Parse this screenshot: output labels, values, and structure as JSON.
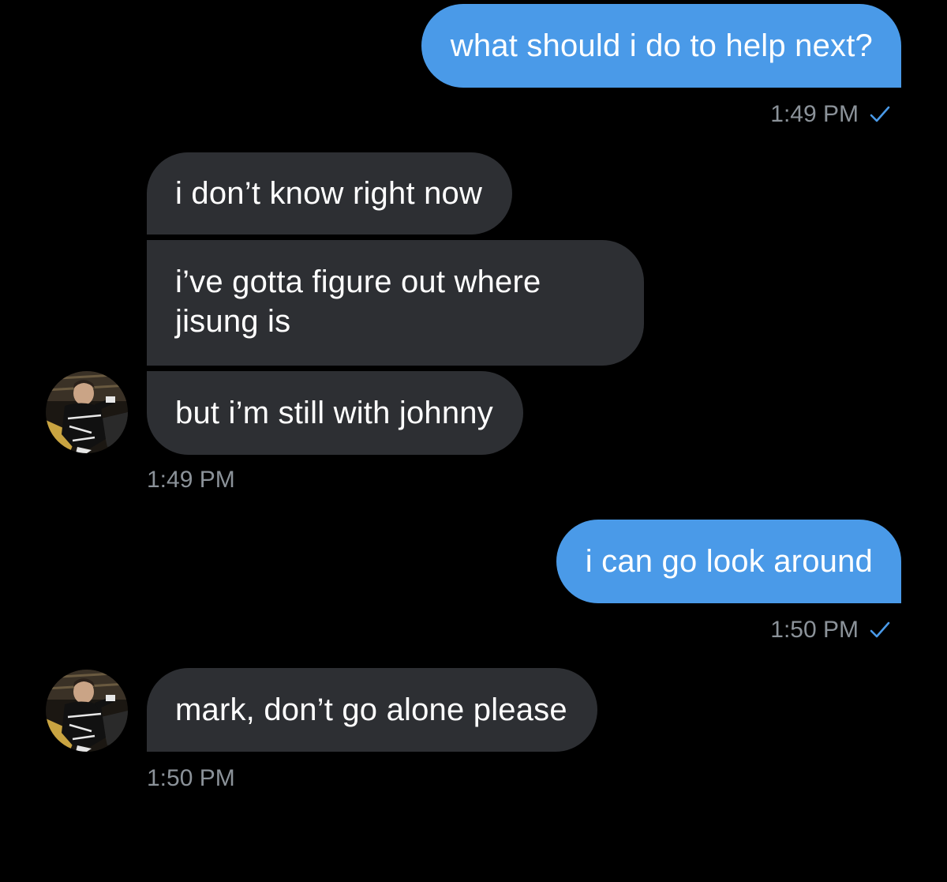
{
  "conversation": {
    "messages": [
      {
        "text": "what should i do to help next?",
        "time": "1:49 PM"
      },
      {
        "text": "i don’t know right now"
      },
      {
        "text": "i’ve gotta figure out where jisung is"
      },
      {
        "text": "but i’m still with johnny",
        "time": "1:49 PM"
      },
      {
        "text": "i can go look around",
        "time": "1:50 PM"
      },
      {
        "text": "mark, don’t go alone please",
        "time": "1:50 PM"
      }
    ]
  },
  "colors": {
    "background": "#000000",
    "outgoing_bubble": "#4a9ae8",
    "incoming_bubble": "#2d2f33",
    "timestamp": "#8b9299",
    "read_check": "#4a9ae8"
  },
  "icons": {
    "read_receipt": "check-icon",
    "contact_avatar": "avatar"
  }
}
